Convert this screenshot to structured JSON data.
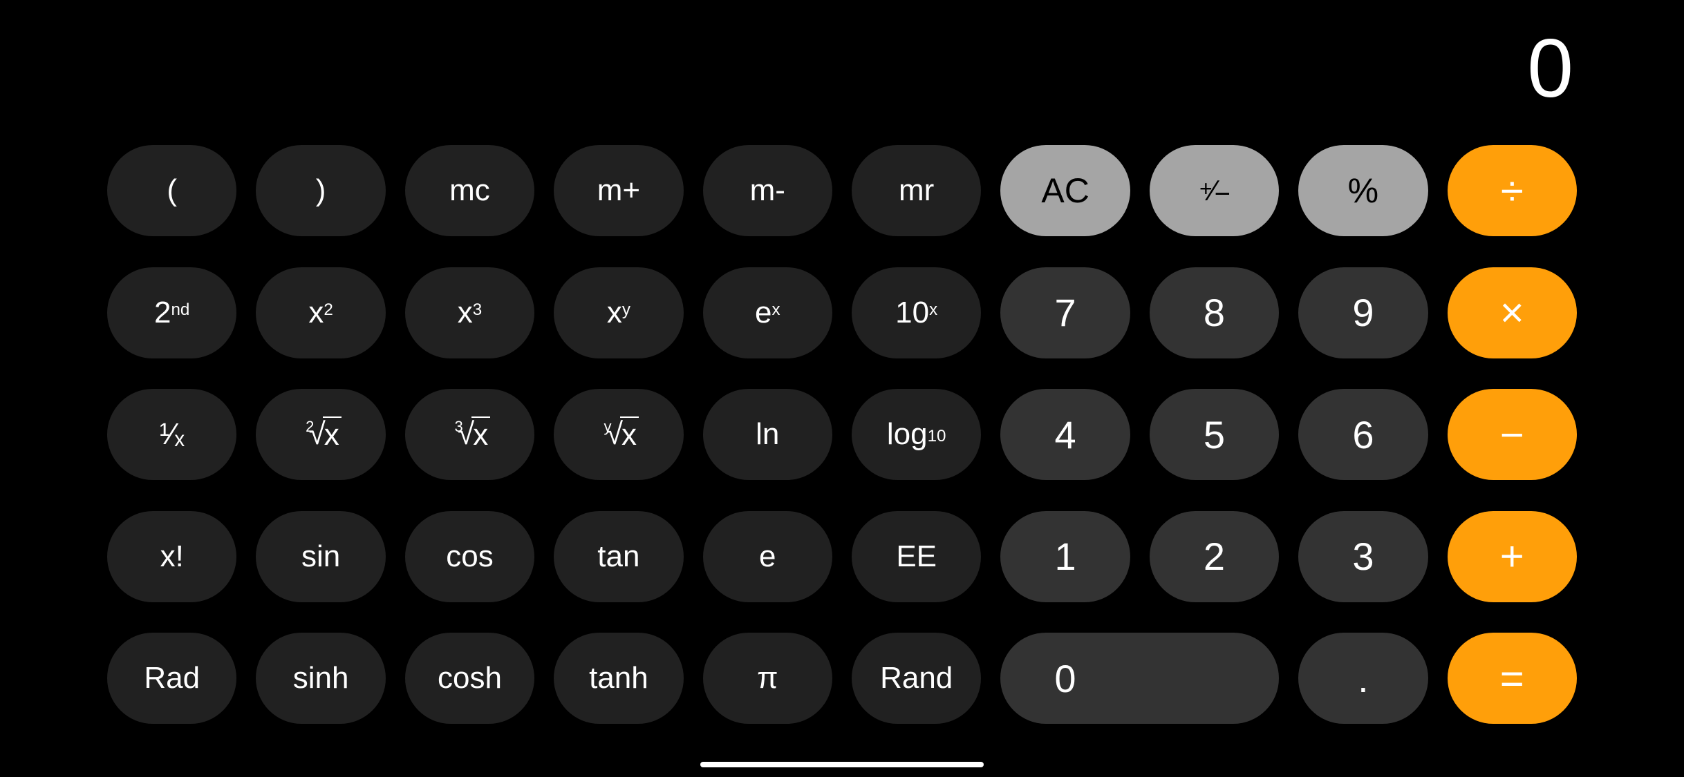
{
  "display": {
    "value": "0"
  },
  "buttons": {
    "open_paren": "(",
    "close_paren": ")",
    "mc": "mc",
    "mplus": "m+",
    "mminus": "m-",
    "mr": "mr",
    "ac": "AC",
    "plus_minus": "+/-",
    "percent": "%",
    "divide": "÷",
    "second_base": "2",
    "second_sup": "nd",
    "x2_base": "x",
    "x2_sup": "2",
    "x3_base": "x",
    "x3_sup": "3",
    "xy_base": "x",
    "xy_sup": "y",
    "ex_base": "e",
    "ex_sup": "x",
    "tenx_base": "10",
    "tenx_sup": "x",
    "seven": "7",
    "eight": "8",
    "nine": "9",
    "multiply": "×",
    "recip": "¹⁄ₓ",
    "sqrt_idx": "2",
    "sqrt_rad": "x",
    "cbrt_idx": "3",
    "cbrt_rad": "x",
    "yroot_idx": "y",
    "yroot_rad": "x",
    "ln": "ln",
    "log10_base": "log",
    "log10_sub": "10",
    "four": "4",
    "five": "5",
    "six": "6",
    "minus": "−",
    "factorial": "x!",
    "sin": "sin",
    "cos": "cos",
    "tan": "tan",
    "e": "e",
    "ee": "EE",
    "one": "1",
    "two": "2",
    "three": "3",
    "plus": "+",
    "rad": "Rad",
    "sinh": "sinh",
    "cosh": "cosh",
    "tanh": "tanh",
    "pi": "π",
    "rand": "Rand",
    "zero": "0",
    "decimal": ".",
    "equals": "="
  }
}
